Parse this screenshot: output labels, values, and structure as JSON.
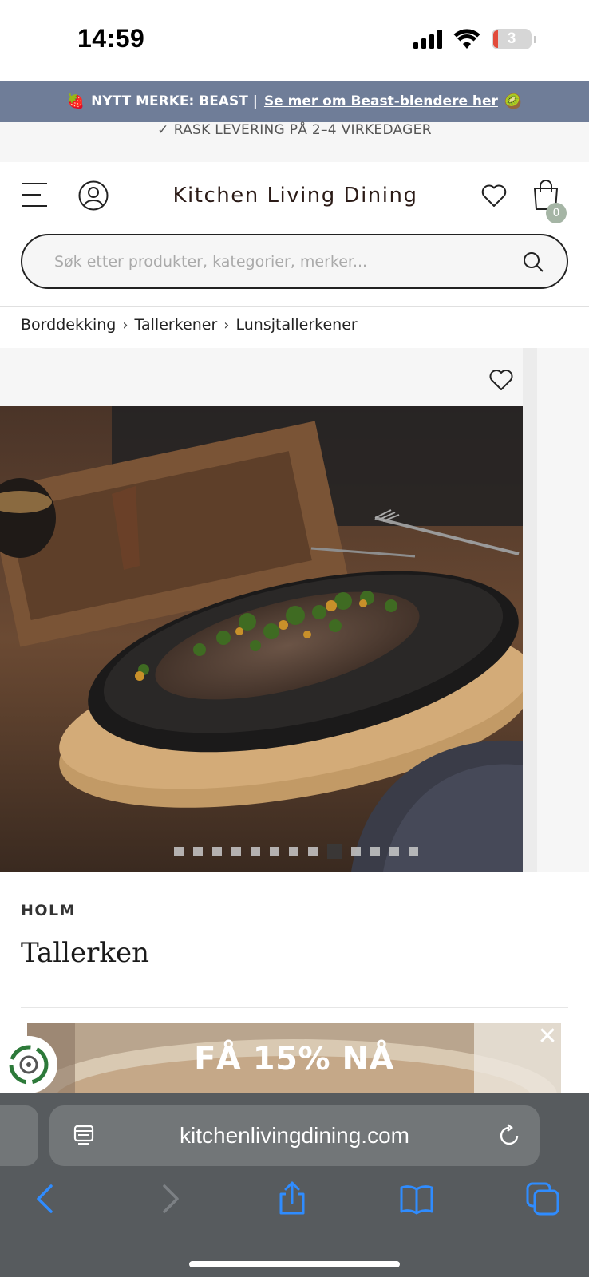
{
  "status_bar": {
    "time": "14:59",
    "battery": "3"
  },
  "promo": {
    "emoji_left": "🍓",
    "text": "NYTT MERKE: BEAST |",
    "link": "Se mer om Beast-blendere her",
    "emoji_right": "🥝"
  },
  "delivery": {
    "check": "✓",
    "text": "RASK LEVERING PÅ 2–4 VIRKEDAGER"
  },
  "header": {
    "logo": "Kitchen Living Dining",
    "cart_count": "0"
  },
  "search": {
    "placeholder": "Søk etter produkter, kategorier, merker..."
  },
  "breadcrumb": {
    "items": [
      "Borddekking",
      "Tallerkener",
      "Lunsjtallerkener"
    ],
    "separator": "›"
  },
  "gallery": {
    "image_count": 13,
    "active_index": 8
  },
  "product": {
    "brand": "HOLM",
    "title": "Tallerken"
  },
  "popup": {
    "text": "FÅ 15% NÅ",
    "close": "✕"
  },
  "browser": {
    "url": "kitchenlivingdining.com"
  },
  "colors": {
    "promo_bg": "#6f7d98",
    "toolbar_blue": "#2f8cff",
    "cart_badge": "#a5b5a5"
  }
}
